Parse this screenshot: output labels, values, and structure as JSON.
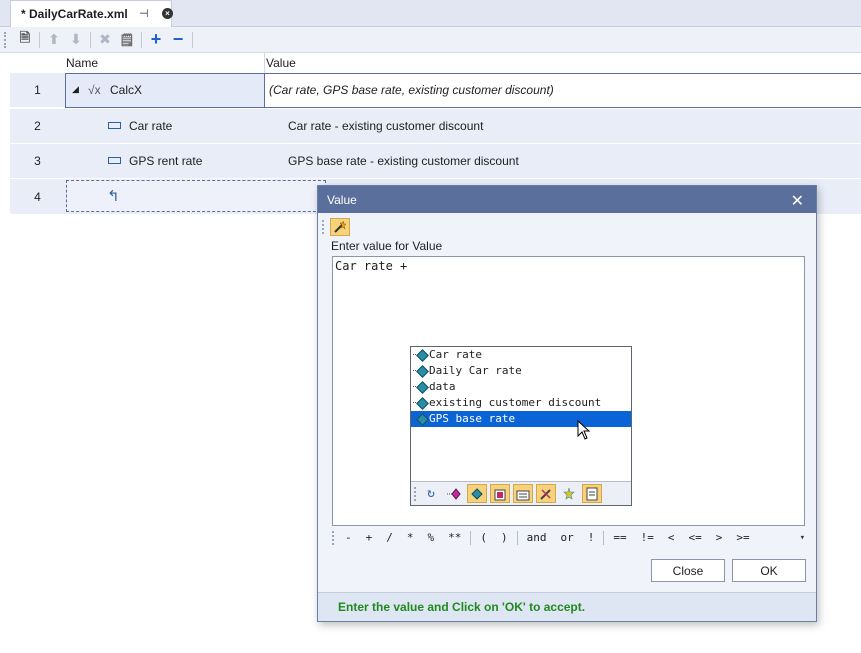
{
  "tab": {
    "title": "* DailyCarRate.xml",
    "pin_glyph": "⊣",
    "close_glyph": "×"
  },
  "toolbar": {
    "new": "🗎",
    "up": "⬆",
    "down": "⬇",
    "delete": "✖",
    "properties": "🗒",
    "add": "+",
    "remove": "−"
  },
  "grid": {
    "headers": {
      "name": "Name",
      "value": "Value"
    },
    "rows": [
      {
        "num": "1",
        "name": "CalcX",
        "value": "(Car rate, GPS base rate, existing customer discount)"
      },
      {
        "num": "2",
        "name": "Car rate",
        "value": "Car rate - existing customer discount"
      },
      {
        "num": "3",
        "name": "GPS rent rate",
        "value": "GPS base rate - existing customer discount"
      },
      {
        "num": "4",
        "name": "",
        "value": ""
      }
    ],
    "expander": "◢",
    "func_icon": "√x",
    "return_icon": "↰"
  },
  "dialog": {
    "title": "Value",
    "close": "✕",
    "prompt": "Enter value for Value",
    "editor_text": "Car rate +",
    "suggestions": [
      "Car rate",
      "Daily Car rate",
      "data",
      "existing customer discount",
      "GPS base rate"
    ],
    "selected_index": 4,
    "operators": [
      "-",
      "+",
      "/",
      "*",
      "%",
      "**",
      "(",
      ")",
      "and",
      "or",
      "!",
      "==",
      "!=",
      "<",
      "<=",
      ">",
      ">="
    ],
    "close_button": "Close",
    "ok_button": "OK",
    "status": "Enter the value and Click on 'OK' to accept."
  }
}
